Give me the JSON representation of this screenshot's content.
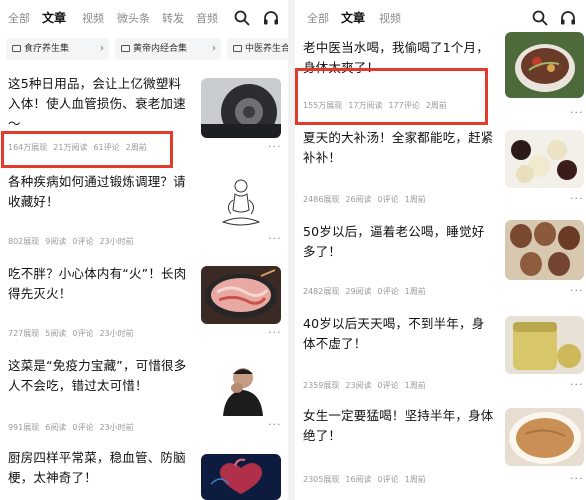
{
  "left": {
    "tabs": [
      "全部",
      "文章",
      "视频",
      "微头条",
      "转发",
      "音频"
    ],
    "active_tab": "文章",
    "chips": [
      "食疗养生集",
      "黄帝内经合集",
      "中医养生合"
    ],
    "items": [
      {
        "title": "这5种日用品，会让上亿微塑料入体！使人血管损伤、衰老加速～",
        "views": "164万展现",
        "reads": "21万阅读",
        "comments": "61评论",
        "time": "2周前",
        "thumb": "car-interior"
      },
      {
        "title": "各种疾病如何通过锻炼调理？请收藏好！",
        "views": "802展现",
        "reads": "9阅读",
        "comments": "0评论",
        "time": "23小时前",
        "thumb": "meditation-sketch"
      },
      {
        "title": "吃不胖？小心体内有“火”！长肉得先灭火！",
        "views": "727展现",
        "reads": "5阅读",
        "comments": "0评论",
        "time": "23小时前",
        "thumb": "meat-hotpot"
      },
      {
        "title": "这菜是“免疫力宝藏”，可惜很多人不会吃，错过太可惜！",
        "views": "991展现",
        "reads": "6阅读",
        "comments": "0评论",
        "time": "23小时前",
        "thumb": "man-coughing"
      },
      {
        "title": "厨房四样平常菜，稳血管、防脑梗，太神奇了！",
        "thumb": "heart-anatomy"
      }
    ]
  },
  "right": {
    "tabs": [
      "全部",
      "文章",
      "视频"
    ],
    "active_tab": "文章",
    "items": [
      {
        "title": "老中医当水喝，我偷喝了1个月，身体太爽了！",
        "views": "155万展现",
        "reads": "17万阅读",
        "comments": "177评论",
        "time": "2周前",
        "thumb": "soup-bowl"
      },
      {
        "title": "夏天的大补汤！全家都能吃，赶紧补补！",
        "views": "2486展现",
        "reads": "26阅读",
        "comments": "0评论",
        "time": "1周前",
        "thumb": "dates-longan"
      },
      {
        "title": "50岁以后，逼着老公喝，睡觉好多了！",
        "views": "2482展现",
        "reads": "29阅读",
        "comments": "0评论",
        "time": "1周前",
        "thumb": "brown-eggs"
      },
      {
        "title": "40岁以后天天喝，不到半年，身体不虚了！",
        "views": "2359展现",
        "reads": "23阅读",
        "comments": "0评论",
        "time": "1周前",
        "thumb": "powder-jar"
      },
      {
        "title": "女生一定要猛喝！坚持半年，身体绝了！",
        "views": "2305展现",
        "reads": "16阅读",
        "comments": "0评论",
        "time": "1周前",
        "thumb": "porridge"
      }
    ]
  },
  "colors": {
    "highlight": "#e23b2e",
    "muted": "#9a9a9a"
  }
}
